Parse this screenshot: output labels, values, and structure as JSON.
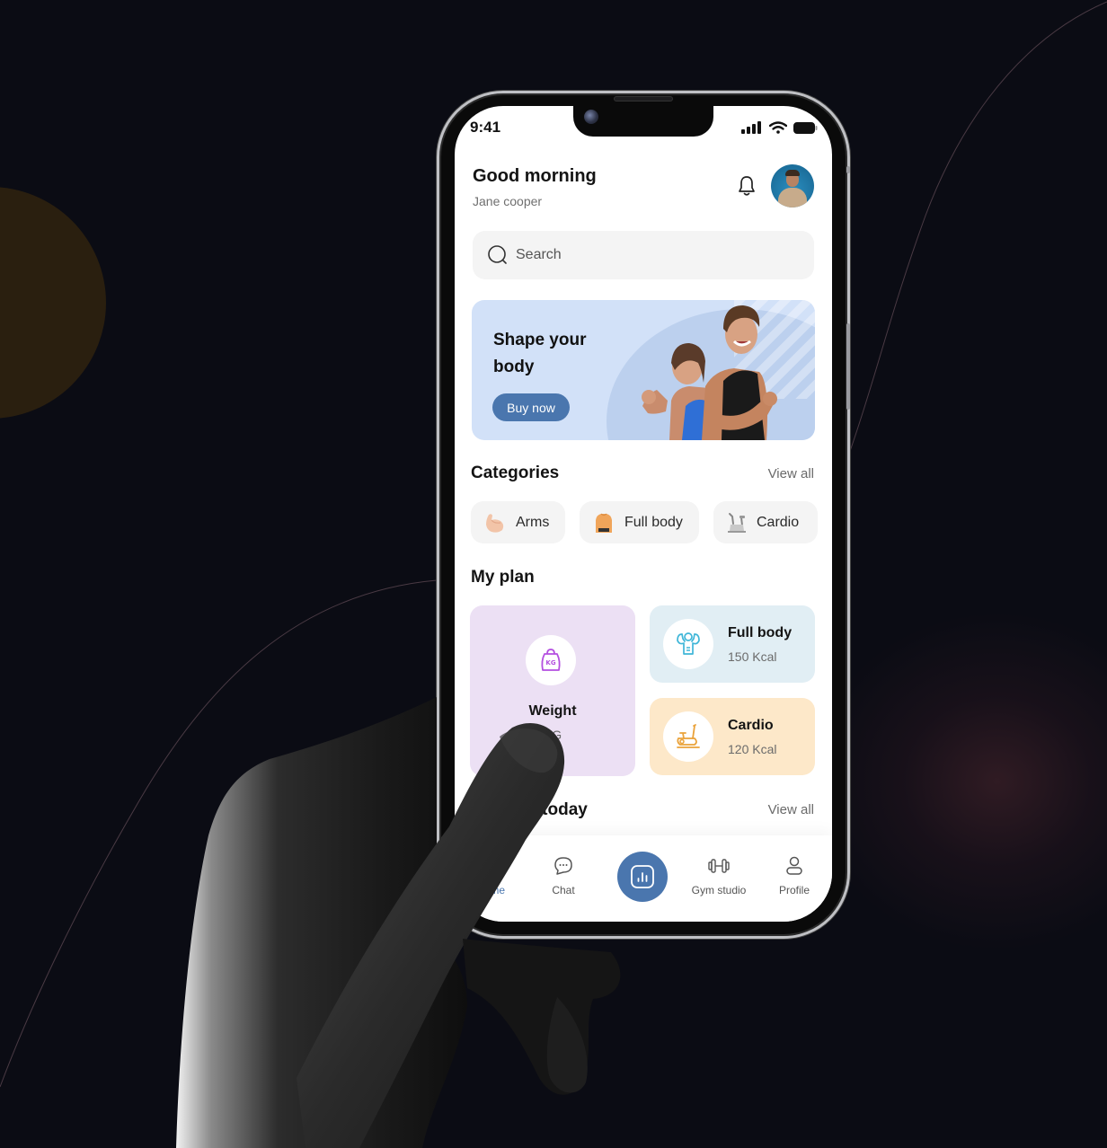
{
  "status_bar": {
    "time": "9:41"
  },
  "header": {
    "greeting": "Good morning",
    "user_name": "Jane cooper"
  },
  "search": {
    "placeholder": "Search",
    "value": ""
  },
  "banner": {
    "title": "Shape your body",
    "button_label": "Buy now"
  },
  "categories": {
    "title": "Categories",
    "view_all": "View all",
    "items": [
      {
        "label": "Arms",
        "icon": "flexed-biceps-icon"
      },
      {
        "label": "Full body",
        "icon": "torso-icon"
      },
      {
        "label": "Cardio",
        "icon": "exercise-bike-icon"
      }
    ]
  },
  "my_plan": {
    "title": "My plan",
    "cards": [
      {
        "title": "Weight",
        "subtitle": "KG",
        "icon": "kettlebell-kg-icon",
        "color": "#ece0f4"
      },
      {
        "title": "Full body",
        "subtitle": "150 Kcal",
        "icon": "muscle-body-icon",
        "color": "#e1eef4"
      },
      {
        "title": "Cardio",
        "subtitle": "120 Kcal",
        "icon": "exercise-bike-icon",
        "color": "#fde8c9"
      }
    ]
  },
  "training_today": {
    "title": "Training today",
    "view_all": "View all"
  },
  "tabbar": {
    "items": [
      {
        "label": "Home",
        "icon": "home-icon",
        "active": true
      },
      {
        "label": "Chat",
        "icon": "chat-bubble-icon"
      },
      {
        "label": "",
        "icon": "stats-chart-icon",
        "center": true
      },
      {
        "label": "Gym studio",
        "icon": "dumbbell-icon"
      },
      {
        "label": "Profile",
        "icon": "user-icon"
      }
    ]
  },
  "colors": {
    "accent": "#4a76ae",
    "background": "#0b0c14",
    "banner_bg": "#d2e1f8",
    "weight_card": "#ece0f4",
    "full_body_card": "#e1eef4",
    "cardio_card": "#fde8c9",
    "weight_icon": "#b44fe0",
    "full_body_icon": "#3fb6d8",
    "cardio_icon": "#eaa23a"
  }
}
